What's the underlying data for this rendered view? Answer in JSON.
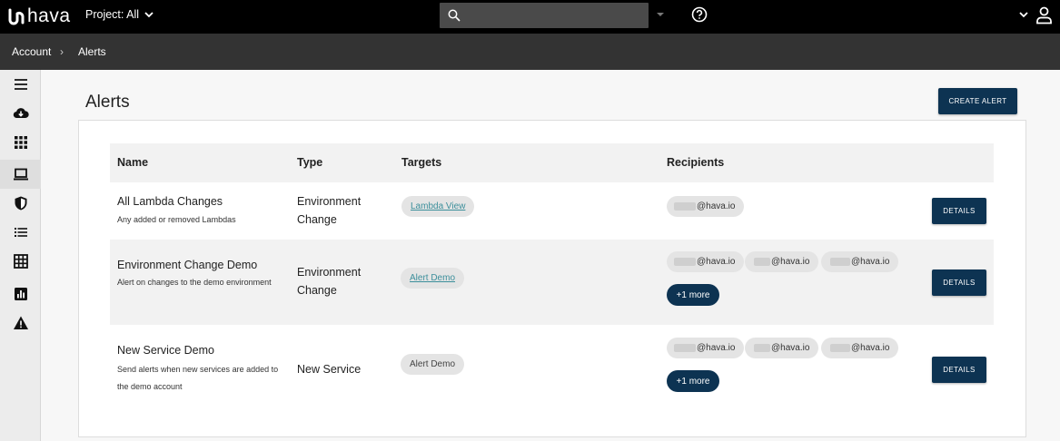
{
  "topbar": {
    "logo_text": "hava",
    "project_label": "Project: All",
    "search_value": ""
  },
  "breadcrumb": {
    "items": [
      "Account",
      "Alerts"
    ],
    "separator": "›"
  },
  "sidebar": {
    "items": [
      {
        "icon": "menu-icon"
      },
      {
        "icon": "cloud-download-icon"
      },
      {
        "icon": "apps-grid-icon"
      },
      {
        "icon": "laptop-icon",
        "active": true
      },
      {
        "icon": "shield-icon"
      },
      {
        "icon": "list-icon"
      },
      {
        "icon": "table-icon"
      },
      {
        "icon": "bar-chart-icon"
      },
      {
        "icon": "warning-icon"
      }
    ]
  },
  "main": {
    "title": "Alerts",
    "create_button": "CREATE ALERT",
    "columns": {
      "name": "Name",
      "type": "Type",
      "targets": "Targets",
      "recipients": "Recipients"
    },
    "rows": [
      {
        "name": "All Lambda Changes",
        "description": "Any added or removed Lambdas",
        "type": "Environment Change",
        "target": "Lambda View",
        "target_is_link": true,
        "recipients": [
          "@hava.io"
        ],
        "more": "",
        "details": "DETAILS"
      },
      {
        "name": "Environment Change Demo",
        "description": "Alert on changes to the demo environment",
        "type": "Environment Change",
        "target": "Alert Demo",
        "target_is_link": true,
        "recipients": [
          "@hava.io",
          "@hava.io",
          "@hava.io"
        ],
        "more": "+1 more",
        "details": "DETAILS"
      },
      {
        "name": "New Service Demo",
        "description": "Send alerts when new services are added to the demo account",
        "type": "New Service",
        "target": "Alert Demo",
        "target_is_link": false,
        "recipients": [
          "@hava.io",
          "@hava.io",
          "@hava.io"
        ],
        "more": "+1 more",
        "details": "DETAILS"
      }
    ]
  },
  "colors": {
    "topbar": "#000000",
    "breadcrumb_bar": "#333333",
    "primary_button": "#0d3352",
    "link": "#3c8f9b"
  }
}
